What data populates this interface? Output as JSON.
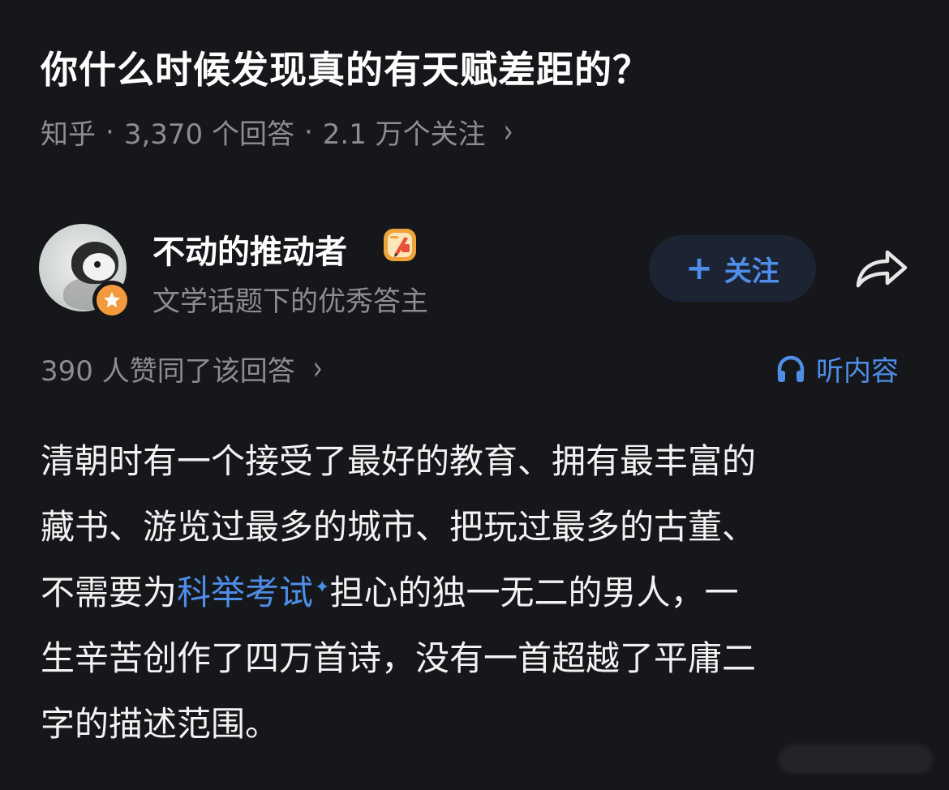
{
  "question": {
    "title": "你什么时候发现真的有天赋差距的？",
    "source": "知乎",
    "answer_count": "3,370 个回答",
    "follower_count": "2.1 万个关注",
    "separator": "·",
    "chevron": "›"
  },
  "author": {
    "name": "不动的推动者",
    "description": "文学话题下的优秀答主",
    "avatar_icon": "penguin-avatar",
    "badge_icon": "star-badge-icon",
    "writer_icon": "pen-writer-icon"
  },
  "actions": {
    "follow_label": "关注",
    "follow_plus": "+",
    "share_icon": "share-arrow-icon"
  },
  "stats": {
    "upvote_text": "390 人赞同了该回答",
    "chevron": "›",
    "listen_label": "听内容",
    "listen_icon": "headphones-icon"
  },
  "answer": {
    "line1": "清朝时有一个接受了最好的教育、拥有最丰富的",
    "line2": "藏书、游览过最多的城市、把玩过最多的古董、",
    "line3_before": "不需要为",
    "line3_link": "科举考试",
    "line3_spark": "✦",
    "line3_after": "担心的独一无二的男人，一",
    "line4": "生辛苦创作了四万首诗，没有一首超越了平庸二",
    "line5": "字的描述范围。"
  },
  "colors": {
    "background": "#16171b",
    "primary_text": "#ffffff",
    "secondary_text": "#8b8d93",
    "accent_blue": "#4e8ee8",
    "badge_orange": "#f39b3c",
    "follow_button_bg": "#1c2433"
  }
}
